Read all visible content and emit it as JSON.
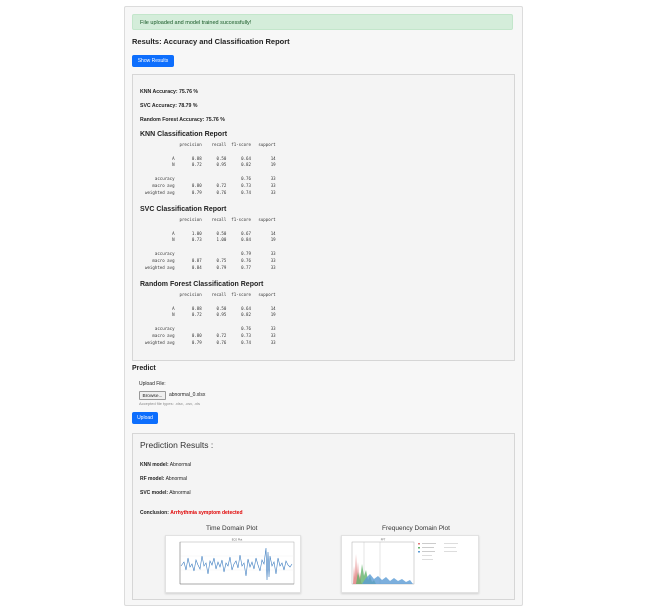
{
  "alert": {
    "message": "File uploaded and model trained successfully!"
  },
  "results": {
    "heading": "Results: Accuracy and Classification Report",
    "show_button": "Show Results",
    "accuracies": [
      "KNN Accuracy: 75.76 %",
      "SVC Accuracy: 78.79 %",
      "Random Forest Accuracy: 75.76 %"
    ],
    "reports": [
      {
        "title": "KNN Classification Report",
        "text": "              precision    recall  f1-score   support\n\n           A       0.88      0.50      0.64        14\n           N       0.72      0.95      0.82        19\n\n    accuracy                           0.76        33\n   macro avg       0.80      0.72      0.73        33\nweighted avg       0.79      0.76      0.74        33"
      },
      {
        "title": "SVC Classification Report",
        "text": "              precision    recall  f1-score   support\n\n           A       1.00      0.50      0.67        14\n           N       0.73      1.00      0.84        19\n\n    accuracy                           0.79        33\n   macro avg       0.87      0.75      0.76        33\nweighted avg       0.84      0.79      0.77        33"
      },
      {
        "title": "Random Forest Classification Report",
        "text": "              precision    recall  f1-score   support\n\n           A       0.88      0.50      0.64        14\n           N       0.72      0.95      0.82        19\n\n    accuracy                           0.76        33\n   macro avg       0.80      0.72      0.73        33\nweighted avg       0.79      0.76      0.74        33"
      }
    ]
  },
  "predict": {
    "heading": "Predict",
    "upload_label": "Upload File:",
    "browse_label": "Browse...",
    "file_name": "abnormal_0.xlsx",
    "accepted_types": "Accepted file types: .xlsx, .csv, .xls",
    "upload_button": "Upload"
  },
  "prediction": {
    "title": "Prediction Results :",
    "knn_label": "KNN model:",
    "knn_value": "Abnormal",
    "rf_label": "RF model:",
    "rf_value": "Abnormal",
    "svc_label": "SVC model:",
    "svc_value": "Abnormal",
    "conclusion_label": "Conclusion:",
    "conclusion_value": "Arrhythmia symptom detected",
    "time_plot_title": "Time Domain Plot",
    "freq_plot_title": "Frequency Domain Plot"
  },
  "colors": {
    "alert_bg": "#d4edda",
    "alert_text": "#155724",
    "primary_button": "#0d6efd",
    "conclusion_red": "#e00000",
    "time_plot_line": "#3a7bbf"
  }
}
